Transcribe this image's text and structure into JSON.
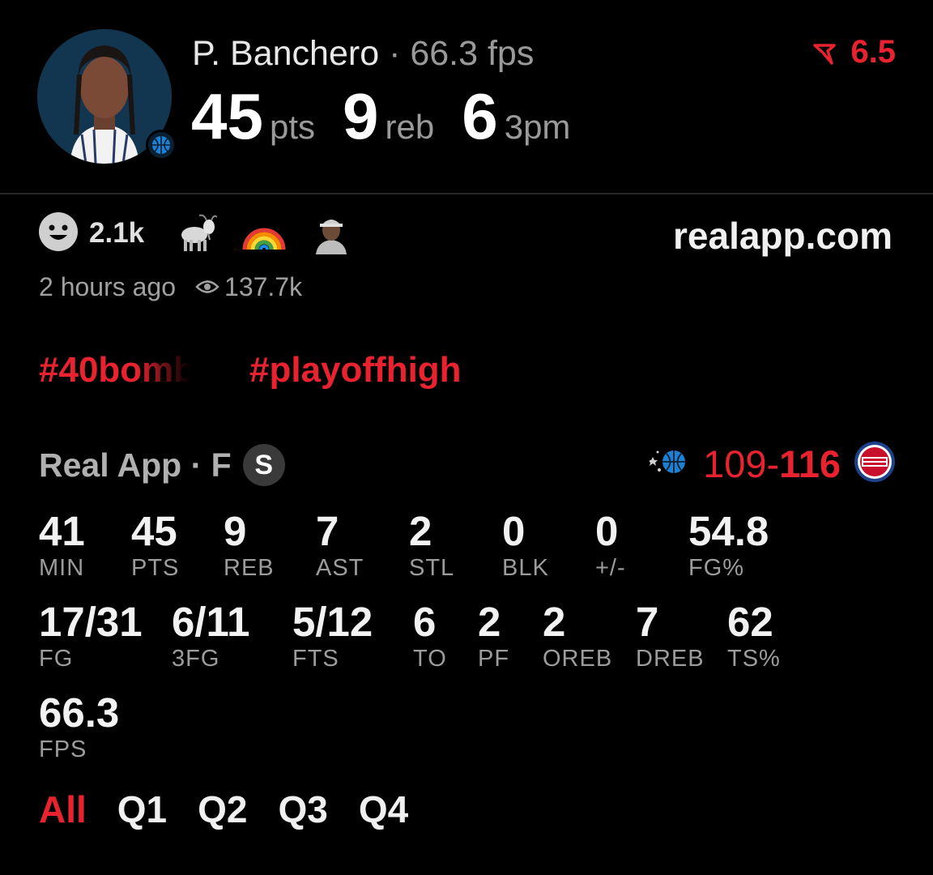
{
  "player": {
    "name": "P. Banchero",
    "separator": "·",
    "fps_label": "66.3 fps",
    "points": "45",
    "points_unit": "pts",
    "rebounds": "9",
    "rebounds_unit": "reb",
    "threes": "6",
    "threes_unit": "3pm"
  },
  "trend": {
    "value": "6.5",
    "color": "#e8232f",
    "icon": "trend-down-icon"
  },
  "reactions": {
    "count": "2.1k",
    "icons": [
      "smiley-icon",
      "goat-emoji",
      "rainbow-emoji",
      "user-avatar-emoji"
    ]
  },
  "site": "realapp.com",
  "meta": {
    "time": "2 hours ago",
    "views": "137.7k"
  },
  "tags": [
    "#40bomb",
    "#playoffhigh"
  ],
  "game": {
    "source": "Real App · F",
    "badge": "S",
    "score_left": "109",
    "score_dash": "-",
    "score_right": "116"
  },
  "stats_row1": [
    {
      "value": "41",
      "label": "MIN"
    },
    {
      "value": "45",
      "label": "PTS"
    },
    {
      "value": "9",
      "label": "REB"
    },
    {
      "value": "7",
      "label": "AST"
    },
    {
      "value": "2",
      "label": "STL"
    },
    {
      "value": "0",
      "label": "BLK"
    },
    {
      "value": "0",
      "label": "+/-"
    },
    {
      "value": "54.8",
      "label": "FG%"
    }
  ],
  "stats_row2": [
    {
      "value": "17/31",
      "label": "FG"
    },
    {
      "value": "6/11",
      "label": "3FG"
    },
    {
      "value": "5/12",
      "label": "FTS"
    },
    {
      "value": "6",
      "label": "TO"
    },
    {
      "value": "2",
      "label": "PF"
    },
    {
      "value": "2",
      "label": "OREB"
    },
    {
      "value": "7",
      "label": "DREB"
    },
    {
      "value": "62",
      "label": "TS%"
    }
  ],
  "stats_row3": [
    {
      "value": "66.3",
      "label": "FPS"
    }
  ],
  "tabs": [
    "All",
    "Q1",
    "Q2",
    "Q3",
    "Q4"
  ],
  "active_tab": "All"
}
